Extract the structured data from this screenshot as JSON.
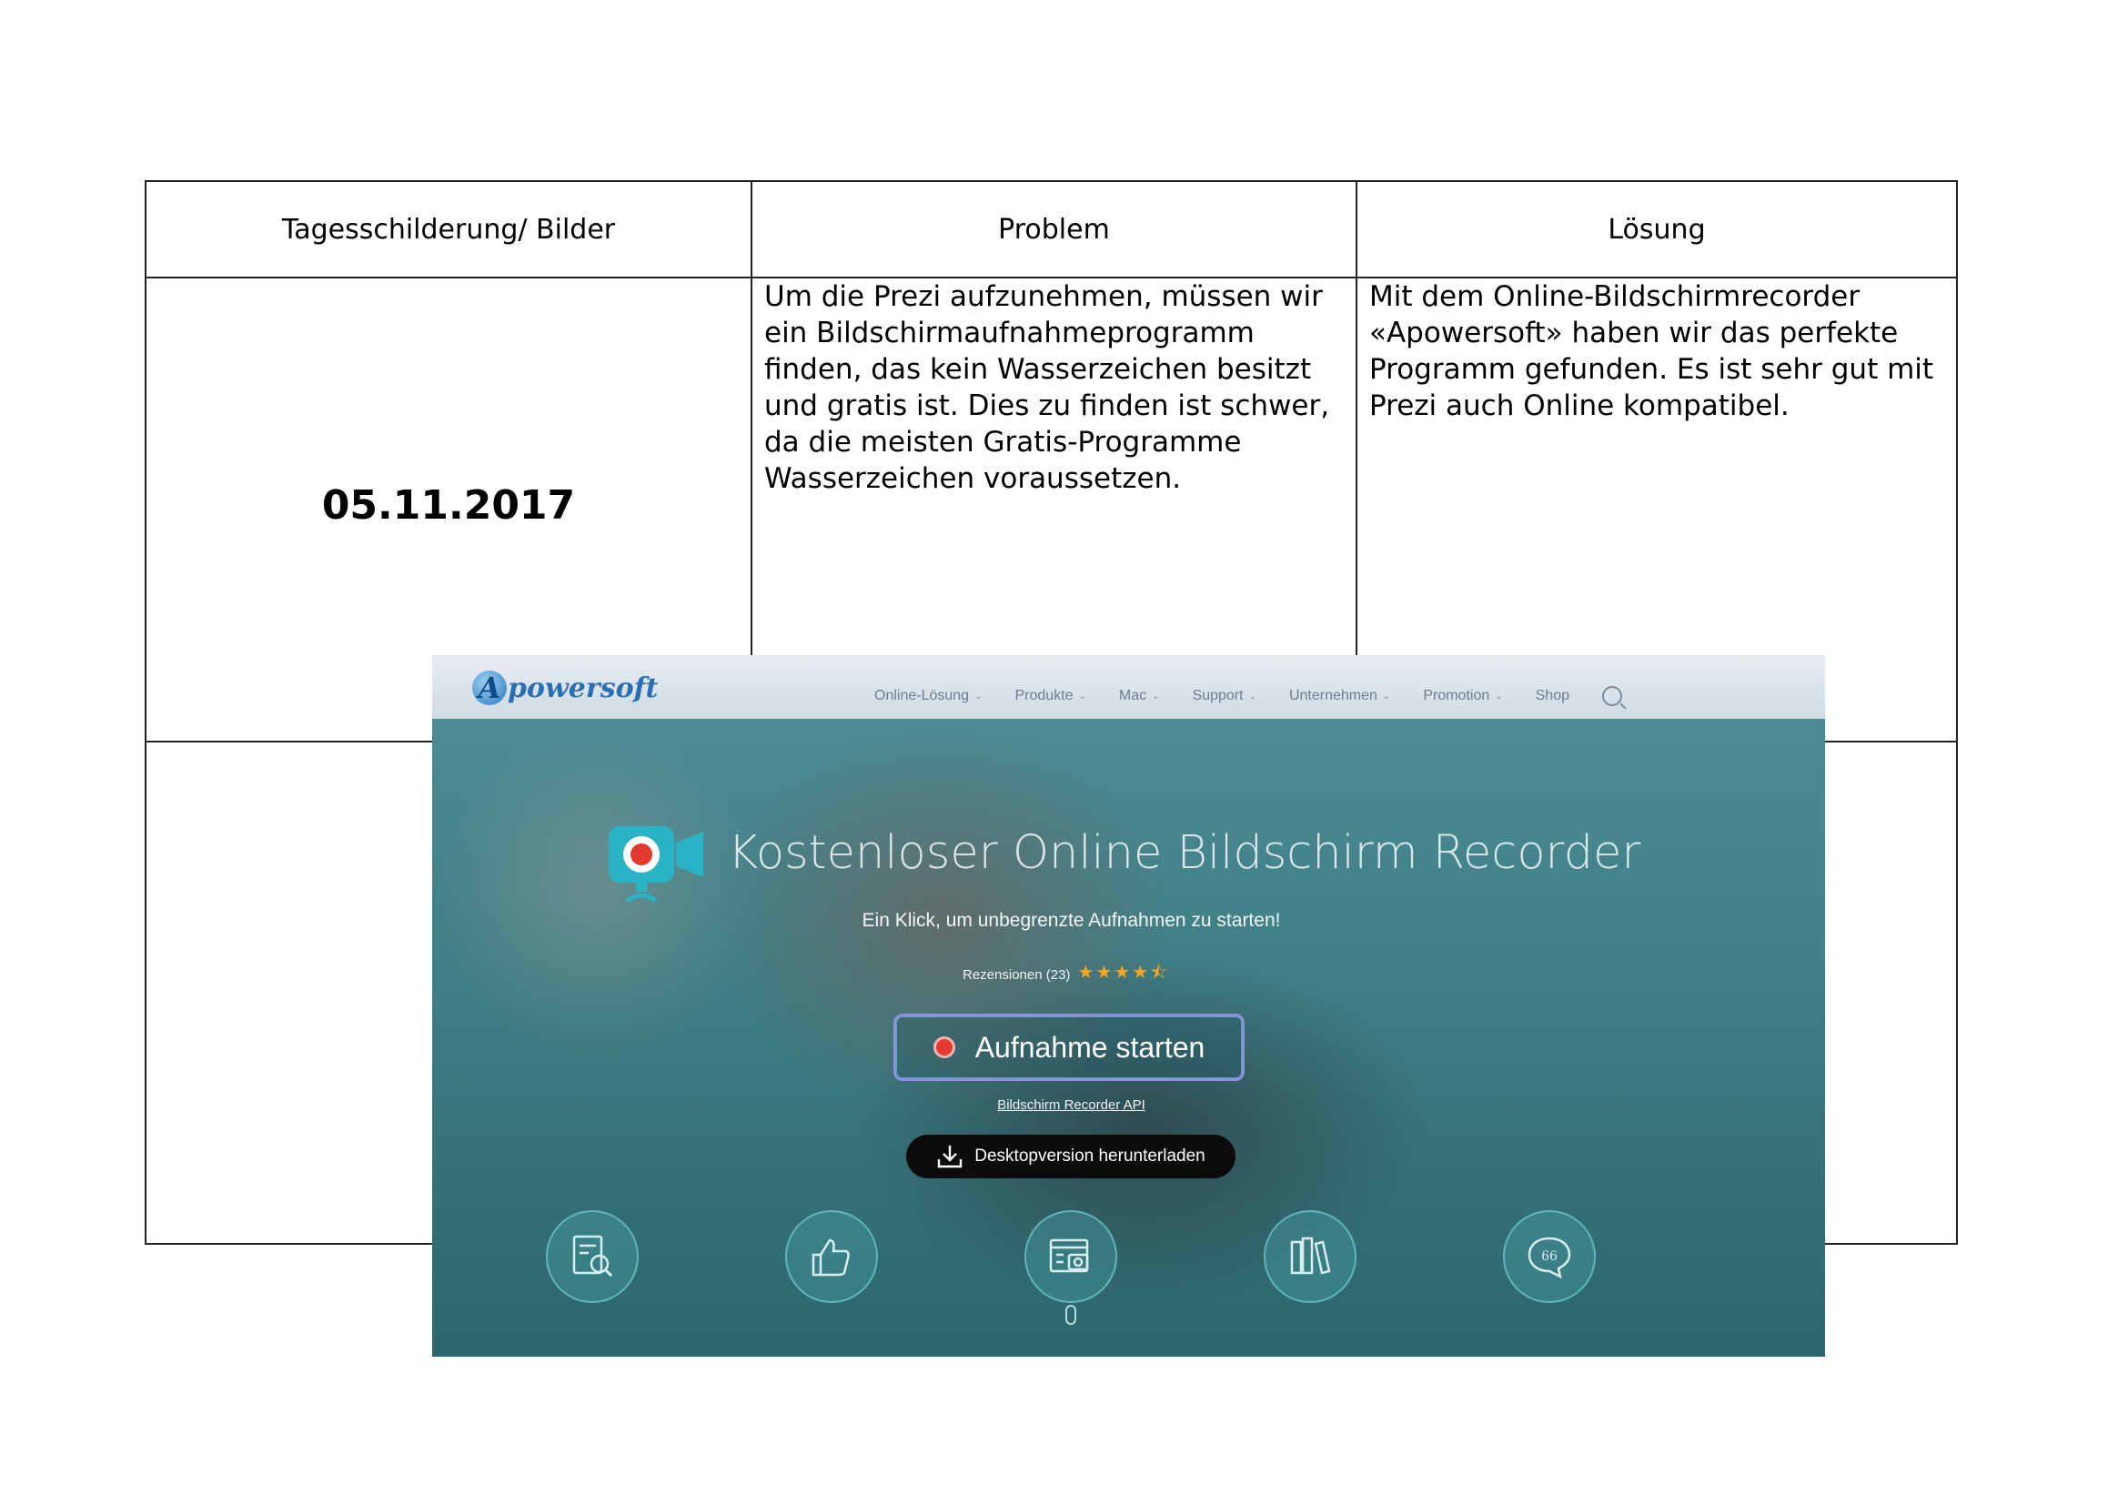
{
  "table": {
    "headers": [
      "Tagesschilderung/ Bilder",
      "Problem",
      "Lösung"
    ],
    "date": "05.11.2017",
    "problem_text": "Um die Prezi aufzunehmen, müssen wir ein Bildschirmaufnahmeprogramm finden, das kein Wasserzeichen besitzt und gratis ist. Dies zu finden ist schwer, da die meisten Gratis-Programme Wasserzeichen voraussetzen.",
    "solution_text": "Mit dem Online-Bildschirmrecorder «Apowersoft» haben wir das perfekte Programm gefunden. Es ist sehr gut mit Prezi auch Online kompatibel."
  },
  "screenshot": {
    "logo_letter": "A",
    "logo_rest": "powersoft",
    "nav": [
      "Online-Lösung",
      "Produkte",
      "Mac",
      "Support",
      "Unternehmen",
      "Promotion",
      "Shop"
    ],
    "hero_title": "Kostenloser Online Bildschirm Recorder",
    "hero_subtitle": "Ein Klick, um unbegrenzte Aufnahmen zu starten!",
    "reviews_label": "Rezensionen (23)",
    "rating": 4.5,
    "start_button": "Aufnahme starten",
    "api_link": "Bildschirm Recorder API",
    "desktop_button": "Desktopversion herunterladen",
    "feature_icons": [
      "search-document-icon",
      "thumbs-up-icon",
      "screenshot-camera-icon",
      "books-icon",
      "quote-bubble-icon"
    ],
    "feature_quote_mark": "66",
    "colors": {
      "accent_teal": "#3f7f86",
      "record_red": "#e23a2e",
      "star": "#f5a623",
      "logo_blue": "#2a6fb4"
    }
  }
}
